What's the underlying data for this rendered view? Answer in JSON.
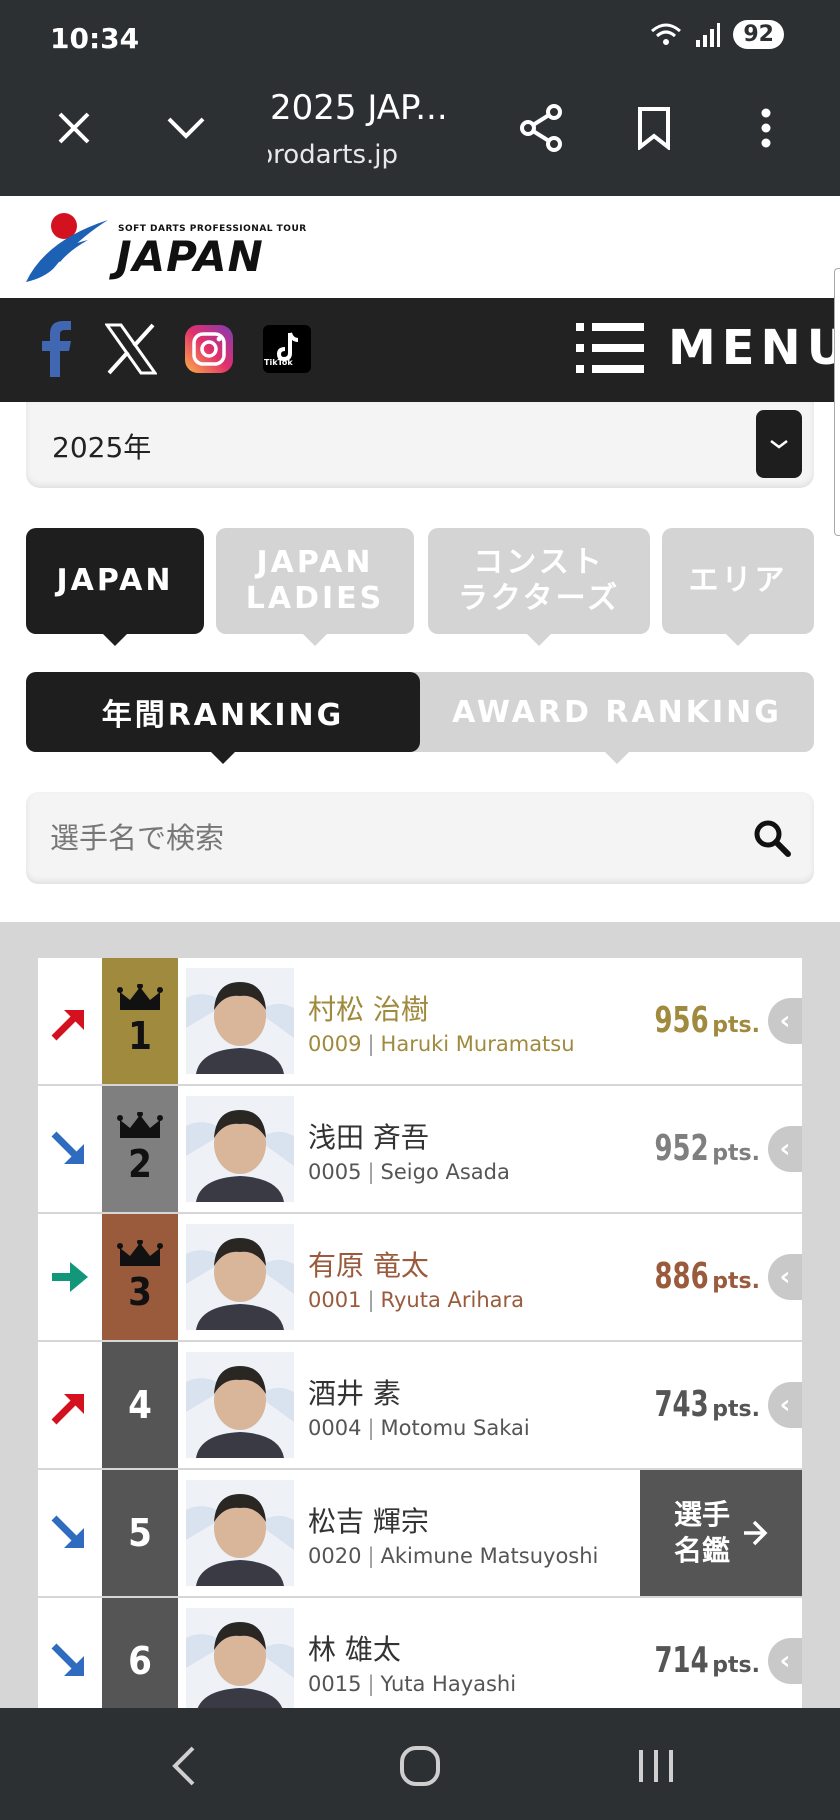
{
  "status": {
    "time": "10:34",
    "battery": "92"
  },
  "browser": {
    "title": "2025 JAP...",
    "host": "prodarts.jp"
  },
  "site": {
    "logo_tagline": "SOFT DARTS PROFESSIONAL TOUR",
    "logo_text": "JAPAN",
    "tiktok_label": "TikTok",
    "menu_label": "MENU"
  },
  "filters": {
    "year": "2025年",
    "categories": [
      {
        "label": "JAPAN",
        "active": true
      },
      {
        "label": "JAPAN\nLADIES",
        "active": false
      },
      {
        "label": "コンスト\nラクターズ",
        "active": false
      },
      {
        "label": "エリア",
        "active": false
      }
    ],
    "ranking_types": [
      {
        "label": "年間RANKING",
        "active": true
      },
      {
        "label": "AWARD RANKING",
        "active": false
      }
    ],
    "search_placeholder": "選手名で検索"
  },
  "ranking": {
    "pts_unit": "pts.",
    "directory_label": "選手\n名鑑",
    "colors": {
      "gold": "#a08a3e",
      "silver": "#7f7f7f",
      "bronze": "#9a5a3c",
      "default": "#555555",
      "up": "#d4121f",
      "down": "#2f6cc0",
      "same": "#12977a"
    },
    "players": [
      {
        "rank": "1",
        "trend": "up",
        "name": "村松 治樹",
        "id": "0009",
        "roman": "Haruki Muramatsu",
        "points": "956",
        "tier": "gold"
      },
      {
        "rank": "2",
        "trend": "down",
        "name": "浅田 斉吾",
        "id": "0005",
        "roman": "Seigo Asada",
        "points": "952",
        "tier": "silver"
      },
      {
        "rank": "3",
        "trend": "same",
        "name": "有原 竜太",
        "id": "0001",
        "roman": "Ryuta Arihara",
        "points": "886",
        "tier": "bronze"
      },
      {
        "rank": "4",
        "trend": "up",
        "name": "酒井 素",
        "id": "0004",
        "roman": "Motomu Sakai",
        "points": "743",
        "tier": "default"
      },
      {
        "rank": "5",
        "trend": "down",
        "name": "松吉 輝宗",
        "id": "0020",
        "roman": "Akimune Matsuyoshi",
        "points": "",
        "tier": "default",
        "expanded": true
      },
      {
        "rank": "6",
        "trend": "down",
        "name": "林 雄太",
        "id": "0015",
        "roman": "Yuta Hayashi",
        "points": "714",
        "tier": "default"
      }
    ]
  }
}
